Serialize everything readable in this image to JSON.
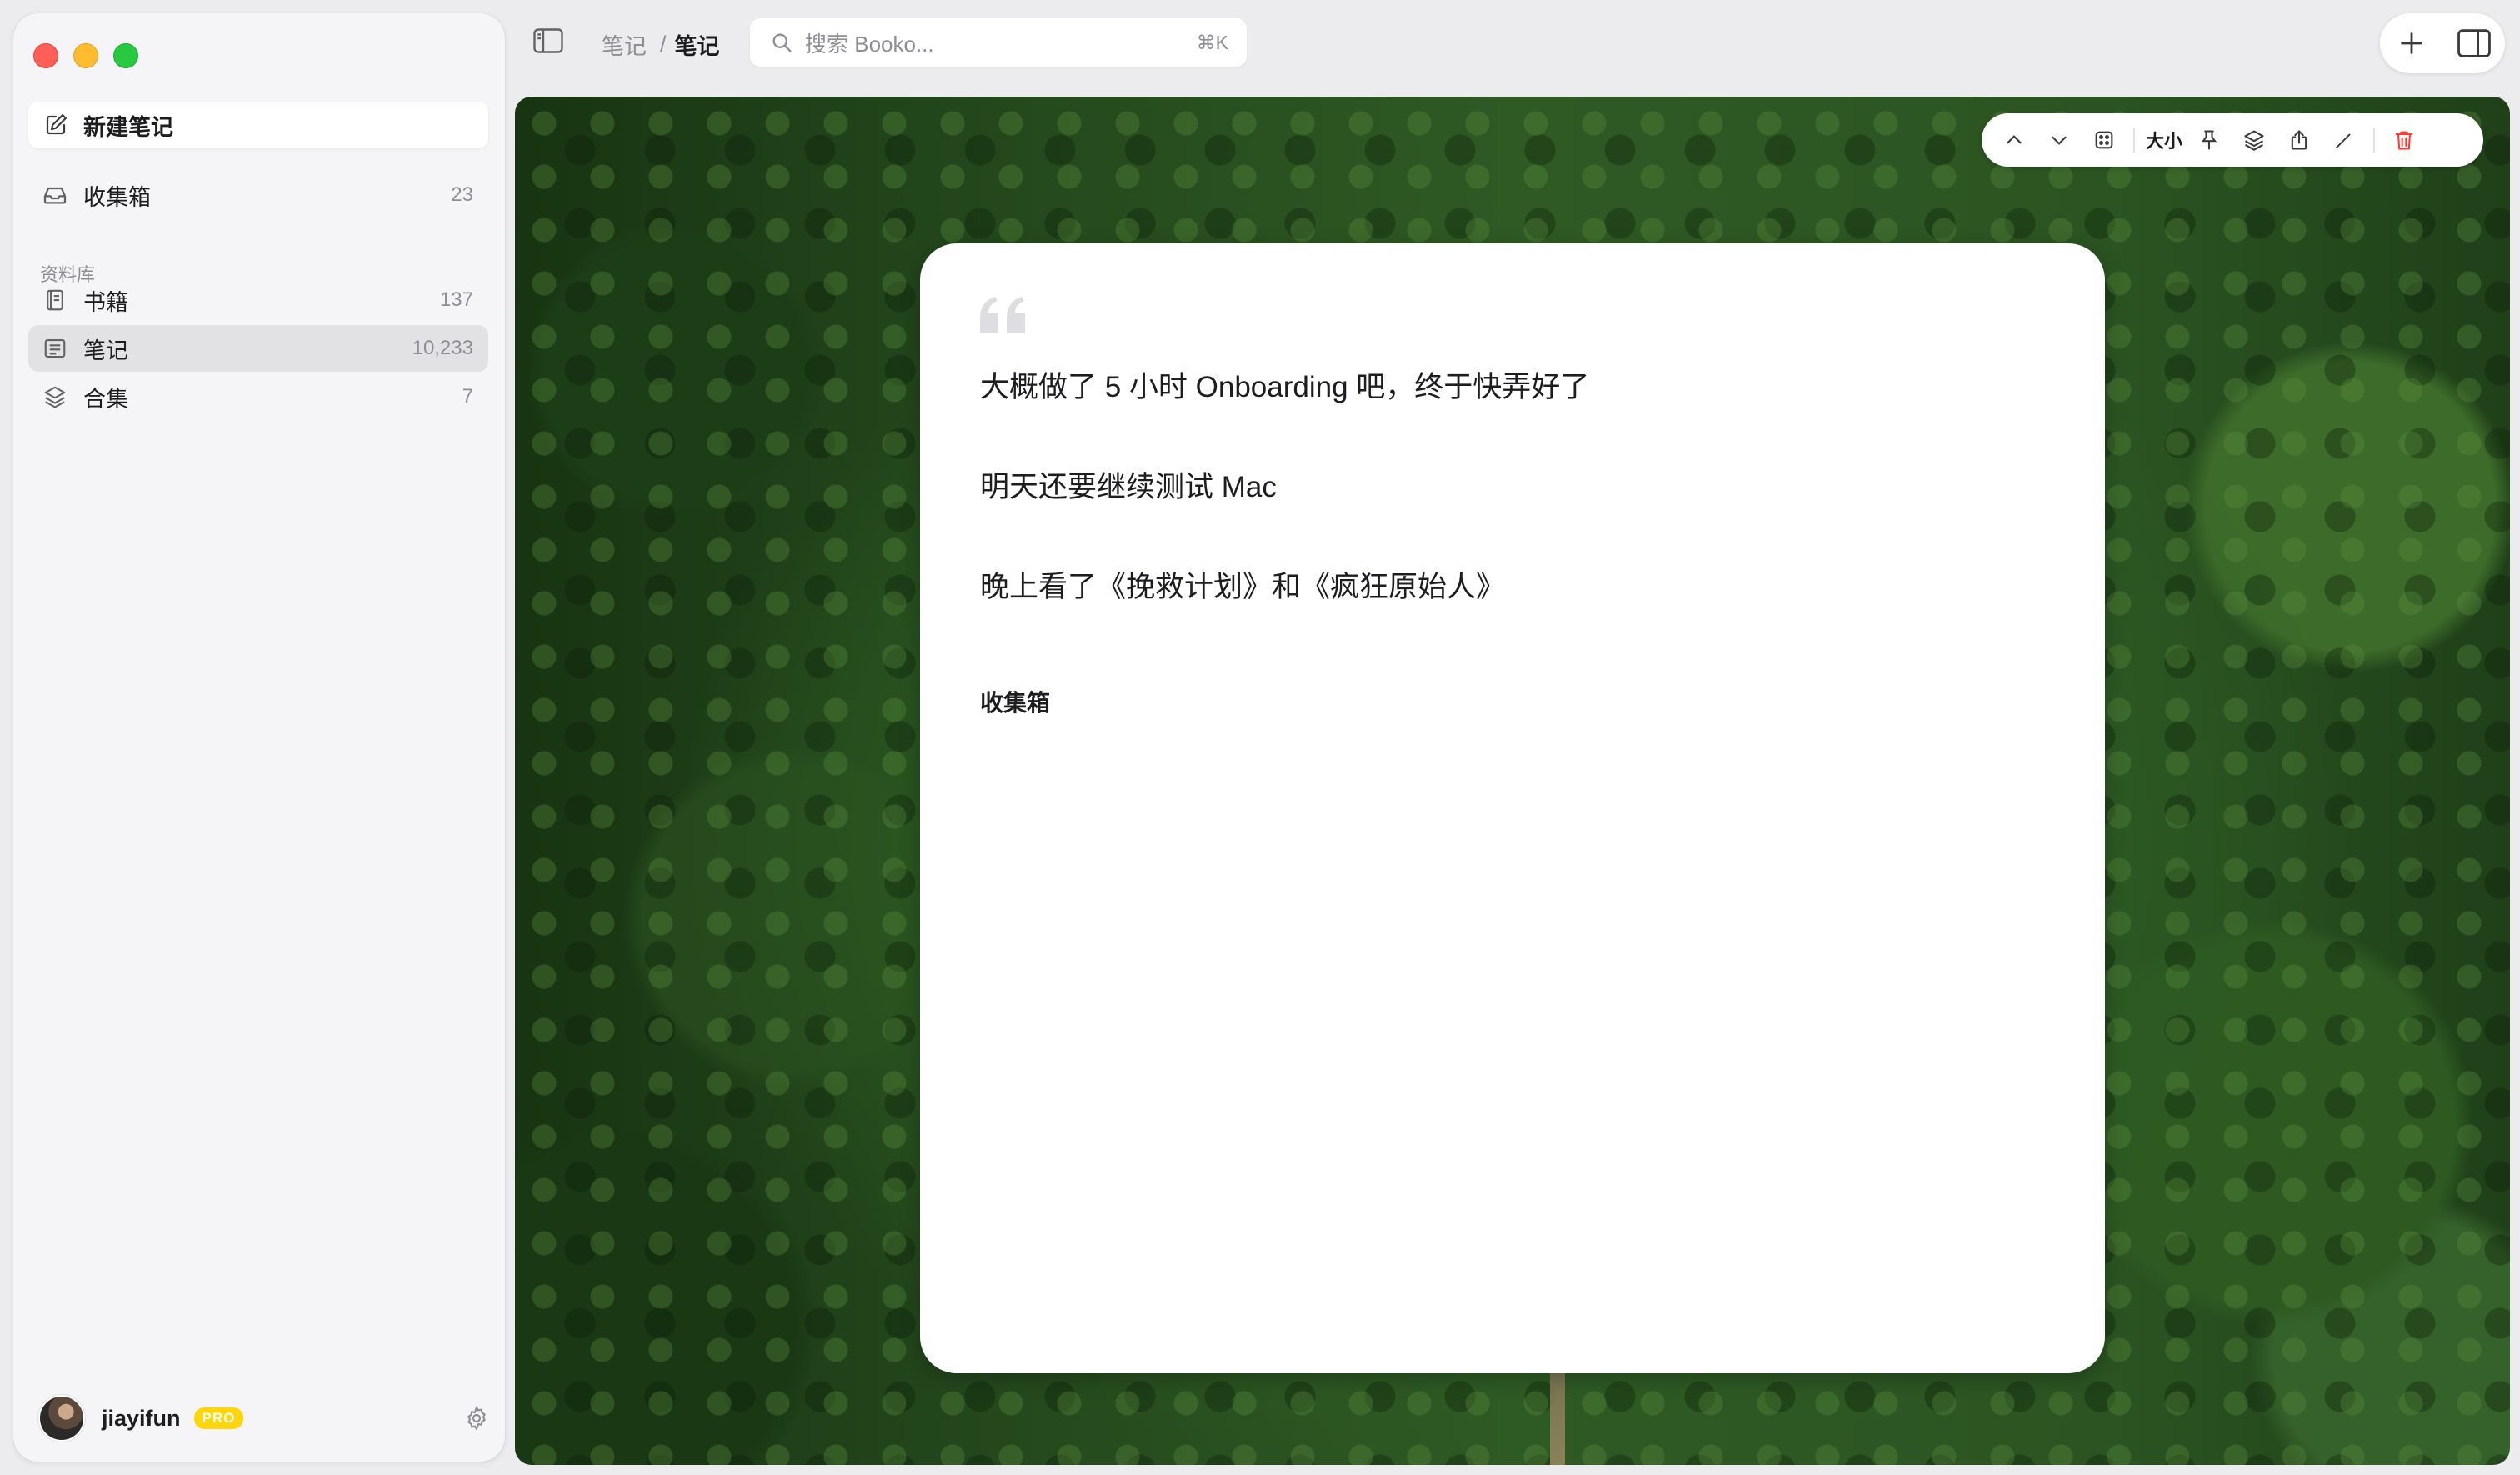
{
  "sidebar": {
    "new_note_label": "新建笔记",
    "inbox": {
      "label": "收集箱",
      "count": "23"
    },
    "library_label": "资料库",
    "items": [
      {
        "label": "书籍",
        "count": "137"
      },
      {
        "label": "笔记",
        "count": "10,233"
      },
      {
        "label": "合集",
        "count": "7"
      }
    ],
    "user": {
      "name": "jiayifun",
      "badge": "PRO"
    }
  },
  "toolbar": {
    "breadcrumb": [
      "笔记",
      "笔记"
    ],
    "breadcrumb_sep": "/",
    "search": {
      "placeholder": "搜索 Booko...",
      "shortcut": "⌘K"
    }
  },
  "note_toolbar": {
    "size_label": "大小"
  },
  "note": {
    "lines": [
      "大概做了 5 小时 Onboarding 吧，终于快弄好了",
      "明天还要继续测试 Mac",
      "晚上看了《挽救计划》和《疯狂原始人》"
    ],
    "tag": "收集箱"
  },
  "colors": {
    "delete_icon": "#ff3b30",
    "pro_badge": "#ffd60a",
    "sidebar_active": "#e2e2e5"
  }
}
